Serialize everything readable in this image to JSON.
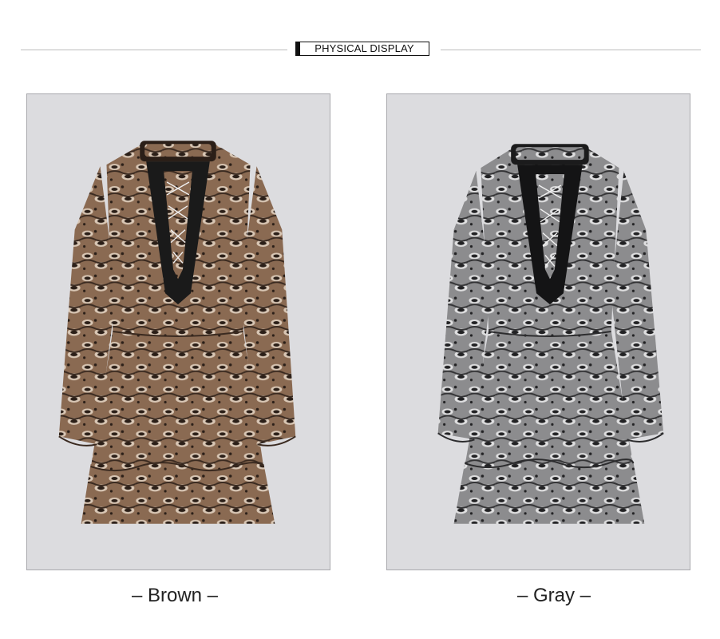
{
  "header": {
    "title": "PHYSICAL DISPLAY"
  },
  "variants": [
    {
      "caption": "– Brown –",
      "dress_icon": "dress-icon",
      "base_color": "#8a6a52",
      "spot_color": "#2b1f18",
      "light_color": "#d8c6b4"
    },
    {
      "caption": "– Gray –",
      "dress_icon": "dress-icon",
      "base_color": "#8c8c8e",
      "spot_color": "#222224",
      "light_color": "#dededf"
    }
  ]
}
